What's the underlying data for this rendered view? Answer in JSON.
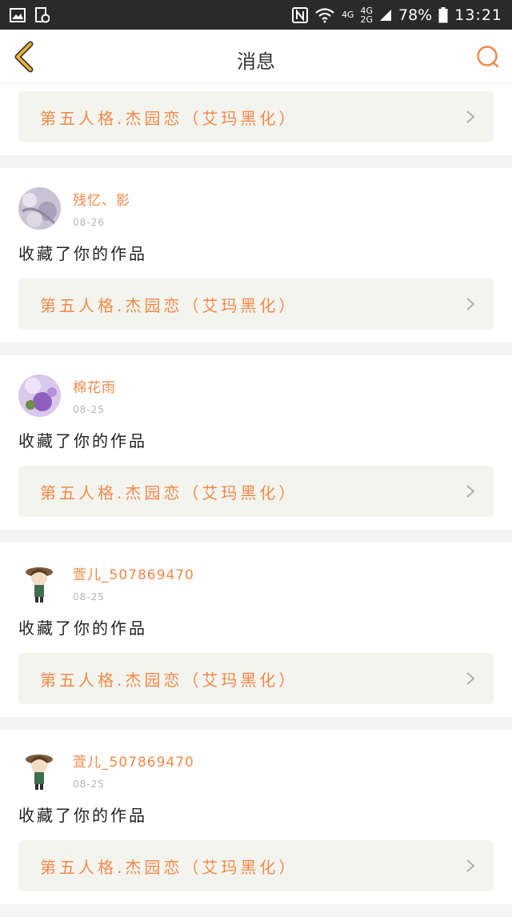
{
  "status_bar": {
    "network_top": "4G",
    "network_mid": "4G",
    "network_bottom": "2G",
    "battery": "78%",
    "time": "13:21"
  },
  "nav": {
    "title": "消息"
  },
  "top_card": {
    "work_title": "第五人格.杰园恋（艾玛黑化）"
  },
  "messages": [
    {
      "user": "残忆、影",
      "date": "08-26",
      "text": "收藏了你的作品",
      "work_title": "第五人格.杰园恋（艾玛黑化）"
    },
    {
      "user": "棉花雨",
      "date": "08-25",
      "text": "收藏了你的作品",
      "work_title": "第五人格.杰园恋（艾玛黑化）"
    },
    {
      "user": "萱儿_507869470",
      "date": "08-25",
      "text": "收藏了你的作品",
      "work_title": "第五人格.杰园恋（艾玛黑化）"
    },
    {
      "user": "萱儿_507869470",
      "date": "08-25",
      "text": "收藏了你的作品",
      "work_title": "第五人格.杰园恋（艾玛黑化）"
    }
  ],
  "colors": {
    "accent": "#f0894a",
    "back_arrow": "#f3b52e",
    "card_link_bg": "#f4f4ee"
  }
}
